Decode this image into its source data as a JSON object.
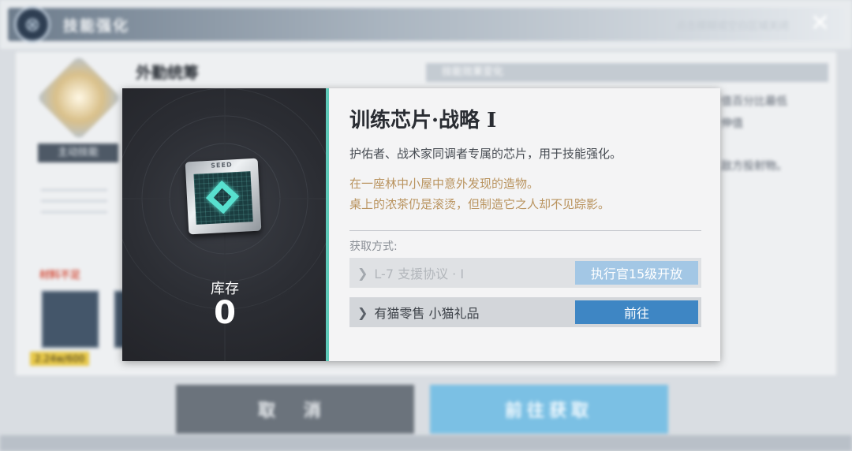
{
  "background": {
    "window_title": "技能强化",
    "hint": "点击模糊或空白区域关闭",
    "close_glyph": "✕",
    "skill_name": "外勤统筹",
    "skill_tag": "主动技能",
    "effect_header": "技能效果变化",
    "right_snippets": [
      "值百分比最低",
      "伸值",
      "敌方投射物。"
    ],
    "materials_label": "材料不足",
    "material_count": "2.24w/600",
    "cancel_label": "取 消",
    "goto_label": "前往获取"
  },
  "item": {
    "name": "训练芯片·战略 I",
    "chip_label": "SEED",
    "stock_label": "库存",
    "stock_value": "0",
    "description": "护佑者、战术家同调者专属的芯片，用于技能强化。",
    "flavor_line1": "在一座林中小屋中意外发现的造物。",
    "flavor_line2": "桌上的浓茶仍是滚烫，但制造它之人却不见踪影。",
    "acquire_label": "获取方式:"
  },
  "sources": [
    {
      "name": "L-7 支援协议 · I",
      "action": "执行官15级开放",
      "status": "locked"
    },
    {
      "name": "有猫零售 小猫礼品",
      "action": "前往",
      "status": "available"
    }
  ],
  "colors": {
    "accent_teal": "#5ec9b8",
    "button_blue": "#3e86c4",
    "locked_blue": "#a3c7e5",
    "flavor_gold": "#b9935e"
  }
}
